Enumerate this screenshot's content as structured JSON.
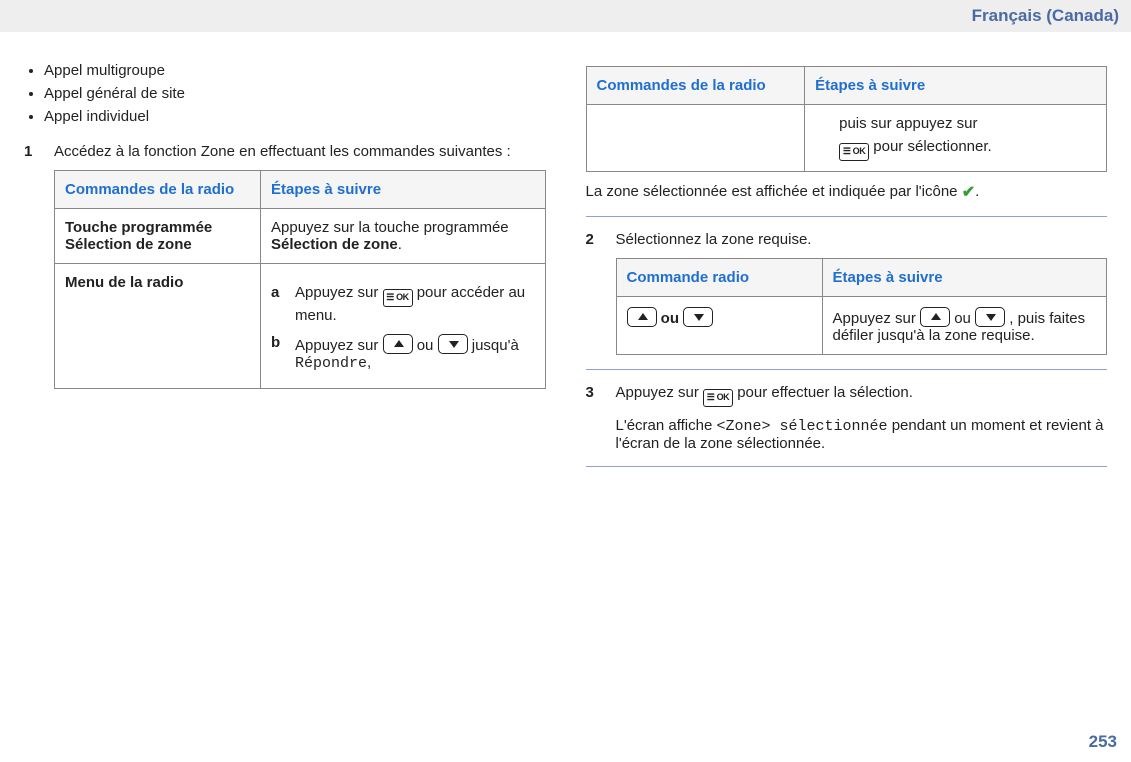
{
  "header": {
    "language": "Français (Canada)"
  },
  "bullets": [
    "Appel multigroupe",
    "Appel général de site",
    "Appel individuel"
  ],
  "step1": {
    "num": "1",
    "text": "Accédez à la fonction Zone en effectuant les commandes suivantes :"
  },
  "table1": {
    "h1": "Commandes de la radio",
    "h2": "Étapes à suivre",
    "r1c1": "Touche programmée Sélection de zone",
    "r1c2_pre": "Appuyez sur la touche programmée ",
    "r1c2_bold": "Sélection de zone",
    "r1c2_post": ".",
    "r2c1": "Menu de la radio",
    "r2_a_label": "a",
    "r2_a_pre": "Appuyez sur ",
    "r2_a_post": " pour accéder au menu.",
    "r2_b_label": "b",
    "r2_b_pre": "Appuyez sur ",
    "r2_b_mid": " ou ",
    "r2_b_post": " jusqu'à ",
    "r2_b_mono": "Répondre",
    "r2_b_end": ","
  },
  "table1b": {
    "h1": "Commandes de la radio",
    "h2": "Étapes à suivre",
    "cont_line1": "puis sur appuyez sur",
    "cont_post": " pour sélectionner."
  },
  "after1": {
    "line_pre": "La zone sélectionnée est affichée et indiquée par l'icône ",
    "line_post": "."
  },
  "step2": {
    "num": "2",
    "text": "Sélectionnez la zone requise."
  },
  "table2": {
    "h1": "Commande radio",
    "h2": "Étapes à suivre",
    "r1c1_mid": " ou ",
    "r1c2_pre": "Appuyez sur ",
    "r1c2_mid": " ou ",
    "r1c2_post": " , puis faites défiler jusqu'à la zone requise."
  },
  "step3": {
    "num": "3",
    "line1_pre": "Appuyez sur ",
    "line1_post": " pour effectuer la sélection.",
    "line2_pre": "L'écran affiche ",
    "line2_mono": "<Zone> sélectionnée",
    "line2_post": " pendant un moment et revient à l'écran de la zone sélectionnée."
  },
  "page_number": "253",
  "icons": {
    "ok_text": "☰ OK"
  }
}
